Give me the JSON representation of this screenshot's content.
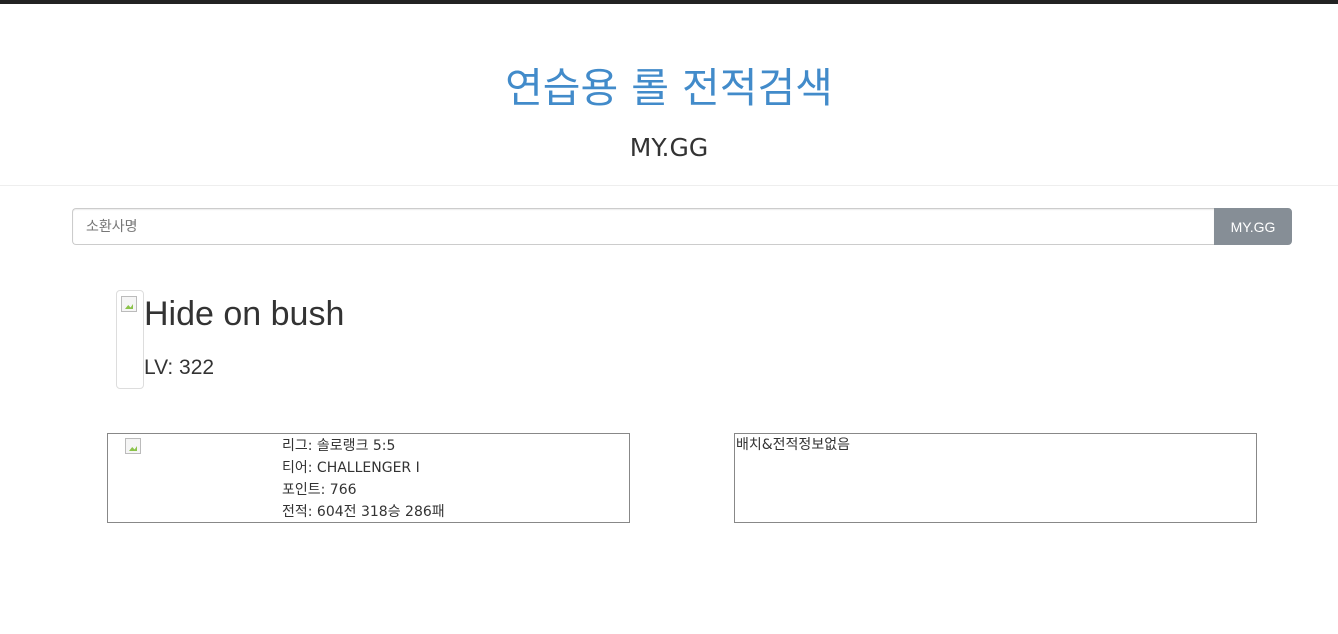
{
  "header": {
    "title": "연습용 롤 전적검색",
    "subtitle": "MY.GG"
  },
  "search": {
    "placeholder": "소환사명",
    "value": "",
    "button_label": "MY.GG"
  },
  "summoner": {
    "name": "Hide on bush",
    "level_text": "LV: 322"
  },
  "solo_rank": {
    "league": "리그: 솔로랭크 5:5",
    "tier": "티어: CHALLENGER I",
    "points": "포인트: 766",
    "record": "전적: 604전 318승 286패"
  },
  "flex_rank": {
    "empty_message": "배치&전적정보없음"
  },
  "colors": {
    "title": "#428bca",
    "button": "#868e96",
    "card_border": "#888888"
  }
}
